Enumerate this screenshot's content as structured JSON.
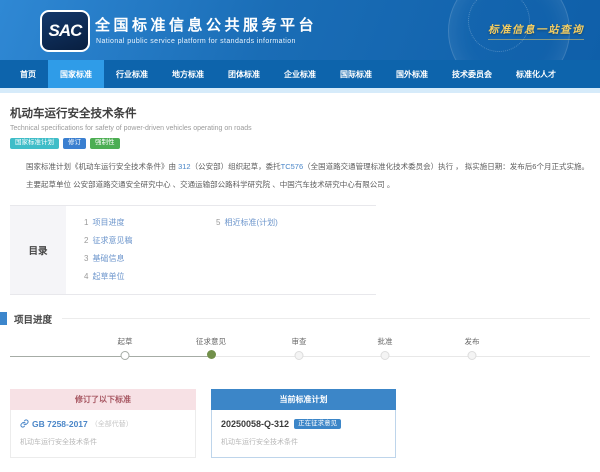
{
  "colors": {
    "header_blue": "#1a6db6",
    "nav_blue": "#0d64ac",
    "nav_active_blue": "#2f9ce8",
    "accent_blue": "#3c86c8",
    "step_current_green": "#72904a",
    "slogan_gold": "#f3cd62"
  },
  "header": {
    "logo_text": "SAC",
    "title": "全国标准信息公共服务平台",
    "subtitle": "National public service platform  for standards information",
    "slogan": "标准信息一站查询"
  },
  "nav": {
    "active": "国家标准",
    "items": [
      "首页",
      "国家标准",
      "行业标准",
      "地方标准",
      "团体标准",
      "企业标准",
      "国际标准",
      "国外标准",
      "技术委员会",
      "标准化人才"
    ]
  },
  "standard": {
    "title": "机动车运行安全技术条件",
    "title_en": "Technical specifications for safety of power-driven vehicles operating on roads",
    "badges": [
      {
        "label": "国家标准计划",
        "style": "background:#3fbdc8"
      },
      {
        "label": "修订",
        "style": "background:#3a7fd0"
      },
      {
        "label": "强制性",
        "style": "background:#4cae53"
      }
    ],
    "summary": {
      "before": "国家标准计划《机动车运行安全技术条件》由 ",
      "link1": "312",
      "mid": "（公安部）组织起草，委托",
      "link2": "TC576",
      "after": "（全国道路交通管理标准化技术委员会）执行 ， 拟实施日期：发布后6个月正式实施。"
    },
    "drafting_units": "主要起草单位 公安部道路交通安全研究中心 、交通运输部公路科学研究院 、中国汽车技术研究中心有限公司 。"
  },
  "catalog": {
    "label": "目录",
    "col1": [
      {
        "num": "1",
        "label": "项目进度"
      },
      {
        "num": "2",
        "label": "征求意见稿"
      },
      {
        "num": "3",
        "label": "基础信息"
      },
      {
        "num": "4",
        "label": "起草单位"
      }
    ],
    "col2": [
      {
        "num": "5",
        "label": "相近标准(计划)"
      }
    ]
  },
  "progress": {
    "section_title": "项目进度",
    "current_step": "征求意见",
    "steps": [
      {
        "label": "起草",
        "state": "done"
      },
      {
        "label": "征求意见",
        "state": "current"
      },
      {
        "label": "审查",
        "state": "todo"
      },
      {
        "label": "批准",
        "state": "todo"
      },
      {
        "label": "发布",
        "state": "todo"
      }
    ]
  },
  "cards": {
    "revised": {
      "header": "修订了以下标准",
      "code": "GB 7258-2017",
      "note": "（全部代替）",
      "name": "机动车运行安全技术条件"
    },
    "current_plan": {
      "header": "当前标准计划",
      "code": "20250058-Q-312",
      "status": "正在征求意见",
      "name": "机动车运行安全技术条件"
    }
  }
}
